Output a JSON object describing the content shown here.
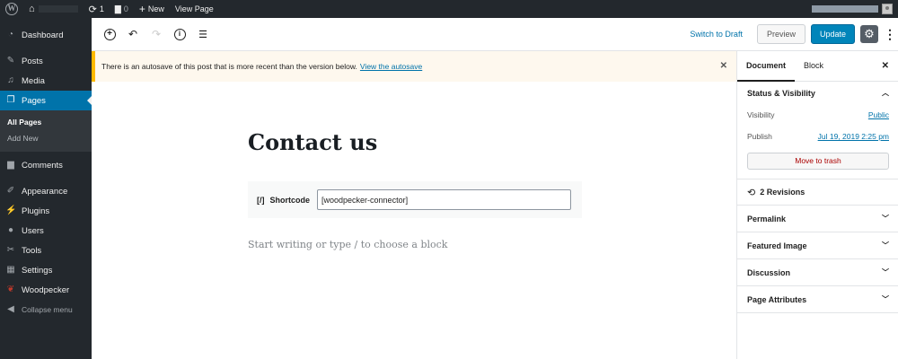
{
  "adminbar": {
    "comments_count": "0",
    "updates_count": "1",
    "new_label": "New",
    "view_page_label": "View Page"
  },
  "menu": {
    "items": [
      {
        "label": "Dashboard",
        "icon": "dashboard-icon"
      },
      {
        "label": "Posts",
        "icon": "pin-icon"
      },
      {
        "label": "Media",
        "icon": "media-icon"
      },
      {
        "label": "Pages",
        "icon": "pages-icon"
      },
      {
        "label": "Comments",
        "icon": "comments-icon"
      },
      {
        "label": "Appearance",
        "icon": "brush-icon"
      },
      {
        "label": "Plugins",
        "icon": "plugin-icon"
      },
      {
        "label": "Users",
        "icon": "users-icon"
      },
      {
        "label": "Tools",
        "icon": "wrench-icon"
      },
      {
        "label": "Settings",
        "icon": "settings-icon"
      },
      {
        "label": "Woodpecker",
        "icon": "woodpecker-icon"
      }
    ],
    "pages_submenu": [
      "All Pages",
      "Add New"
    ],
    "collapse_label": "Collapse menu"
  },
  "header": {
    "switch_to_draft": "Switch to Draft",
    "preview": "Preview",
    "update": "Update"
  },
  "notice": {
    "text": "There is an autosave of this post that is more recent than the version below.",
    "link": "View the autosave"
  },
  "content": {
    "title": "Contact us",
    "shortcode_icon": "[/]",
    "shortcode_label": "Shortcode",
    "shortcode_value": "[woodpecker-connector]",
    "placeholder": "Start writing or type / to choose a block"
  },
  "sidebar": {
    "tabs": [
      "Document",
      "Block"
    ],
    "status_title": "Status & Visibility",
    "visibility_label": "Visibility",
    "visibility_value": "Public",
    "publish_label": "Publish",
    "publish_value": "Jul 19, 2019 2:25 pm",
    "trash_label": "Move to trash",
    "revisions": "2 Revisions",
    "panels": [
      "Permalink",
      "Featured Image",
      "Discussion",
      "Page Attributes"
    ]
  },
  "colors": {
    "admin_dark": "#23282d",
    "accent_blue": "#0073aa",
    "update_blue": "#0085ba",
    "notice_bg": "#fef8ee",
    "notice_border": "#ffb900"
  }
}
